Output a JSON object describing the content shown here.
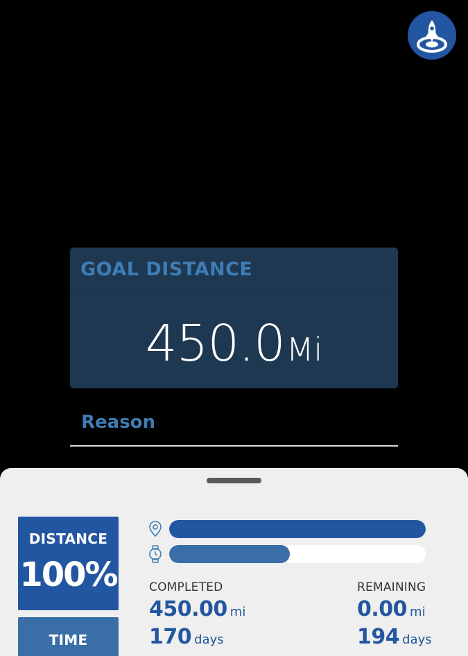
{
  "goal": {
    "title": "GOAL DISTANCE",
    "value": "450.0",
    "unit": "Mi"
  },
  "reason": {
    "label": "Reason"
  },
  "tiles": {
    "distance": {
      "label": "DISTANCE",
      "percent": "100%"
    },
    "time": {
      "label": "TIME"
    }
  },
  "progress": {
    "distance_fraction": 1.0,
    "time_fraction": 0.47,
    "distance_color": "#2356a0",
    "time_color": "#3a6ea6"
  },
  "stats": {
    "completed_label": "COMPLETED",
    "remaining_label": "REMAINING",
    "completed_distance": "450.00",
    "completed_distance_unit": "mi",
    "completed_days": "170",
    "completed_days_unit": "days",
    "remaining_distance": "0.00",
    "remaining_distance_unit": "mi",
    "remaining_days": "194",
    "remaining_days_unit": "days"
  },
  "icons": {
    "fab": "rocket-target-icon",
    "distance_row": "location-pin-icon",
    "time_row": "watch-icon"
  },
  "colors": {
    "accent": "#2356a0",
    "card_bg": "#1e3852",
    "label_blue": "#3f7cb3",
    "sheet_bg": "#efefef"
  }
}
